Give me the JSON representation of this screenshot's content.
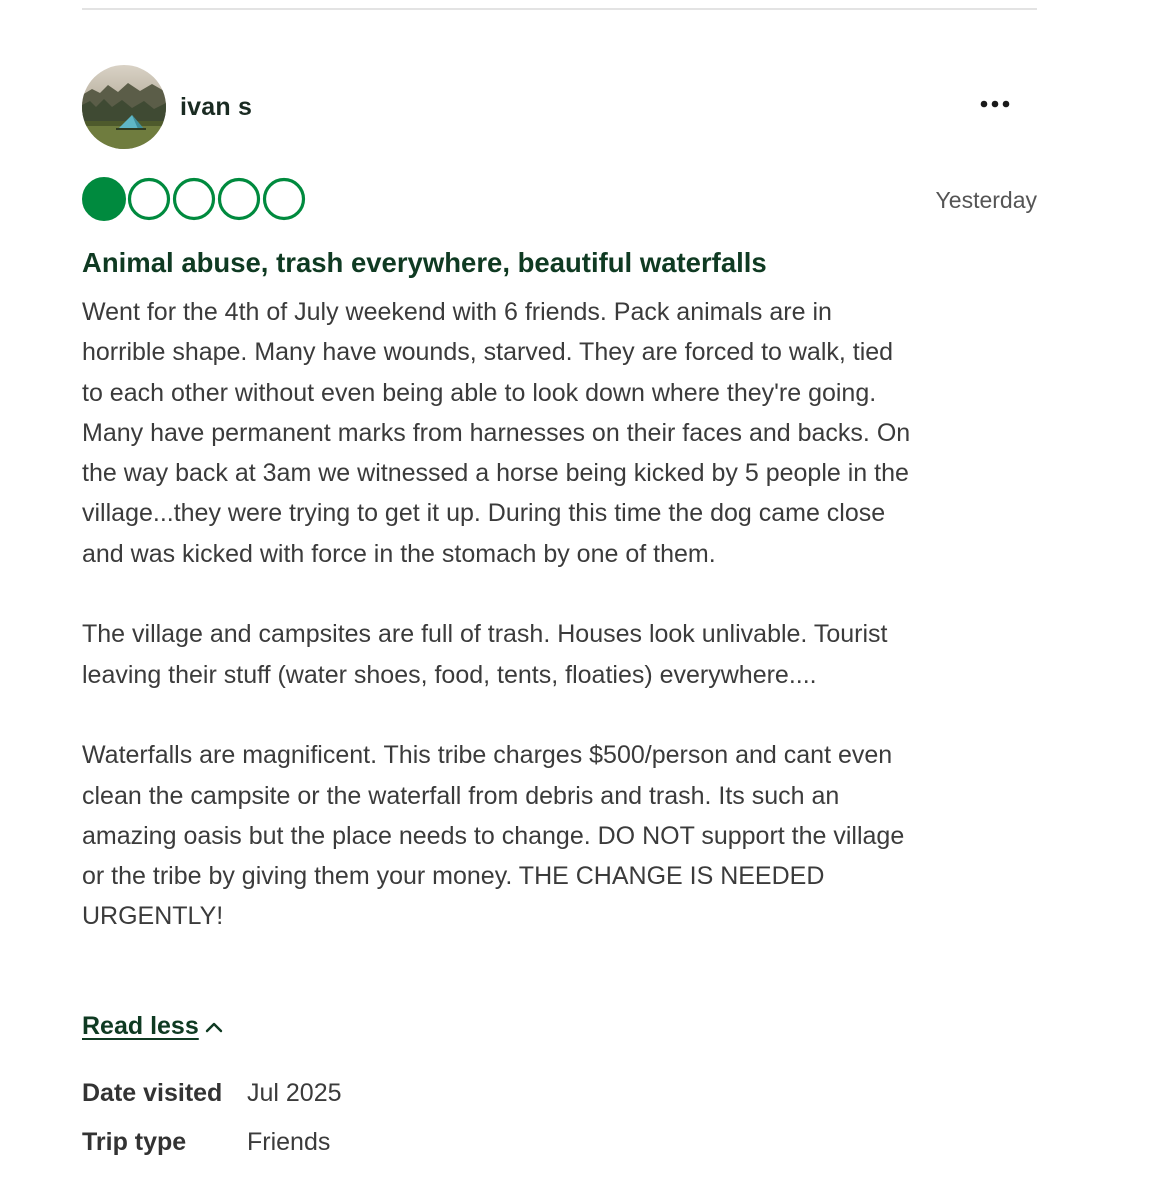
{
  "review": {
    "reviewer": {
      "name": "ivan s",
      "avatar_icon": "tent-landscape-avatar"
    },
    "menu_icon": "more-options-icon",
    "rating": {
      "value": 1,
      "max": 5,
      "filled_color": "#00aa6c",
      "accent_color": "#008a3e"
    },
    "date_label": "Yesterday",
    "title": "Animal abuse, trash everywhere, beautiful waterfalls",
    "body": {
      "paragraph1": [
        "Went for the 4th of July weekend with 6 friends. Pack animals are in",
        "horrible shape. Many have wounds, starved. They are forced to walk, tied",
        "to each other without even being able to look down where they're going.",
        "Many have permanent marks from harnesses on their faces and backs. On",
        "the way back at 3am we witnessed a horse being kicked by 5 people in the",
        "village...they were trying to get it up. During this time the dog came close",
        "and was kicked with force in the stomach by one of them."
      ],
      "paragraph2": [
        "The village and campsites are full of trash. Houses look unlivable. Tourist",
        "leaving their stuff (water shoes, food, tents, floaties) everywhere...."
      ],
      "paragraph3": [
        "Waterfalls are magnificent. This tribe charges $500/person and cant even",
        "clean the campsite or the waterfall from debris and trash. Its such an",
        "amazing oasis but the place needs to change. DO NOT support the village",
        "or the tribe by giving them your money. THE CHANGE IS NEEDED",
        "URGENTLY!"
      ]
    },
    "read_less_label": "Read less",
    "read_less_icon": "chevron-up-icon",
    "meta": {
      "date_visited_label": "Date visited",
      "date_visited_value": "Jul 2025",
      "trip_type_label": "Trip type",
      "trip_type_value": "Friends"
    }
  }
}
